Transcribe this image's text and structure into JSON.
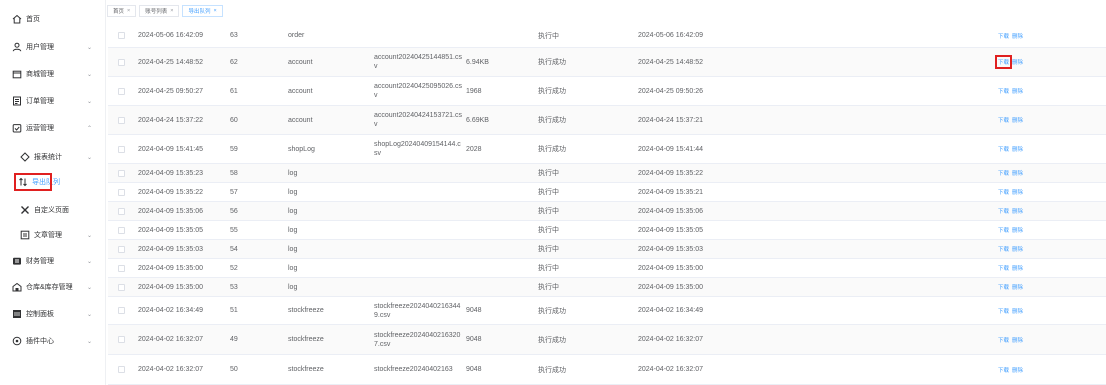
{
  "sidebar": {
    "items": [
      {
        "label": "首页",
        "icon": "home-icon"
      },
      {
        "label": "用户管理",
        "icon": "user-icon"
      },
      {
        "label": "商城管理",
        "icon": "shop-icon"
      },
      {
        "label": "订单管理",
        "icon": "order-icon"
      },
      {
        "label": "运营管理",
        "icon": "operations-icon"
      },
      {
        "label": "报表统计",
        "icon": "report-icon"
      },
      {
        "label": "导出队列",
        "icon": "export-queue-icon"
      },
      {
        "label": "自定义页面",
        "icon": "custom-page-icon"
      },
      {
        "label": "文章管理",
        "icon": "article-icon"
      },
      {
        "label": "财务管理",
        "icon": "finance-icon"
      },
      {
        "label": "仓库&库存管理",
        "icon": "warehouse-icon"
      },
      {
        "label": "控制面板",
        "icon": "dashboard-icon"
      },
      {
        "label": "插件中心",
        "icon": "plugin-icon"
      }
    ]
  },
  "tabs": [
    {
      "label": "首页",
      "close": "×"
    },
    {
      "label": "账号列表",
      "close": "×"
    },
    {
      "label": "导出队列",
      "close": "×"
    }
  ],
  "ops": {
    "download": "下载",
    "delete": "删除"
  },
  "rows": [
    {
      "ctime": "2024-05-06 16:42:09",
      "id": "63",
      "type": "order",
      "file": "",
      "size": "",
      "status": "执行中",
      "ftime": "2024-05-06 16:42:09"
    },
    {
      "ctime": "2024-04-25 14:48:52",
      "id": "62",
      "type": "account",
      "file": "account20240425144851.csv",
      "size": "6.94KB",
      "status": "执行成功",
      "ftime": "2024-04-25 14:48:52"
    },
    {
      "ctime": "2024-04-25 09:50:27",
      "id": "61",
      "type": "account",
      "file": "account20240425095026.csv",
      "size": "1968",
      "status": "执行成功",
      "ftime": "2024-04-25 09:50:26"
    },
    {
      "ctime": "2024-04-24 15:37:22",
      "id": "60",
      "type": "account",
      "file": "account20240424153721.csv",
      "size": "6.69KB",
      "status": "执行成功",
      "ftime": "2024-04-24 15:37:21"
    },
    {
      "ctime": "2024-04-09 15:41:45",
      "id": "59",
      "type": "shopLog",
      "file": "shopLog20240409154144.csv",
      "size": "2028",
      "status": "执行成功",
      "ftime": "2024-04-09 15:41:44"
    },
    {
      "ctime": "2024-04-09 15:35:23",
      "id": "58",
      "type": "log",
      "file": "",
      "size": "",
      "status": "执行中",
      "ftime": "2024-04-09 15:35:22"
    },
    {
      "ctime": "2024-04-09 15:35:22",
      "id": "57",
      "type": "log",
      "file": "",
      "size": "",
      "status": "执行中",
      "ftime": "2024-04-09 15:35:21"
    },
    {
      "ctime": "2024-04-09 15:35:06",
      "id": "56",
      "type": "log",
      "file": "",
      "size": "",
      "status": "执行中",
      "ftime": "2024-04-09 15:35:06"
    },
    {
      "ctime": "2024-04-09 15:35:05",
      "id": "55",
      "type": "log",
      "file": "",
      "size": "",
      "status": "执行中",
      "ftime": "2024-04-09 15:35:05"
    },
    {
      "ctime": "2024-04-09 15:35:03",
      "id": "54",
      "type": "log",
      "file": "",
      "size": "",
      "status": "执行中",
      "ftime": "2024-04-09 15:35:03"
    },
    {
      "ctime": "2024-04-09 15:35:00",
      "id": "52",
      "type": "log",
      "file": "",
      "size": "",
      "status": "执行中",
      "ftime": "2024-04-09 15:35:00"
    },
    {
      "ctime": "2024-04-09 15:35:00",
      "id": "53",
      "type": "log",
      "file": "",
      "size": "",
      "status": "执行中",
      "ftime": "2024-04-09 15:35:00"
    },
    {
      "ctime": "2024-04-02 16:34:49",
      "id": "51",
      "type": "stockfreeze",
      "file": "stockfreeze20240402163449.csv",
      "size": "9048",
      "status": "执行成功",
      "ftime": "2024-04-02 16:34:49"
    },
    {
      "ctime": "2024-04-02 16:32:07",
      "id": "49",
      "type": "stockfreeze",
      "file": "stockfreeze20240402163207.csv",
      "size": "9048",
      "status": "执行成功",
      "ftime": "2024-04-02 16:32:07"
    },
    {
      "ctime": "2024-04-02 16:32:07",
      "id": "50",
      "type": "stockfreeze",
      "file": "stockfreeze20240402163",
      "size": "9048",
      "status": "执行成功",
      "ftime": "2024-04-02 16:32:07"
    }
  ]
}
